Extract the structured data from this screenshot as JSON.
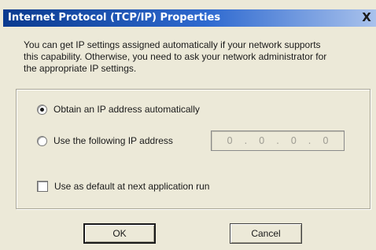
{
  "window": {
    "title": "Internet Protocol (TCP/IP) Properties",
    "close_glyph": "X"
  },
  "intro": {
    "line1": "You can get IP settings assigned automatically if your network supports",
    "line2": "this capability. Otherwise, you need to ask  your network administrator  for",
    "line3": "the appropriate  IP settings."
  },
  "options": {
    "auto_label": "Obtain an IP address automatically",
    "auto_selected": true,
    "manual_label": "Use the following IP address",
    "manual_selected": false,
    "ip_octets": [
      "0",
      "0",
      "0",
      "0"
    ],
    "ip_separator": ".",
    "default_label": "Use as default at next application run",
    "default_checked": false
  },
  "buttons": {
    "ok": "OK",
    "cancel": "Cancel"
  },
  "colors": {
    "dialog_bg": "#ece9d8",
    "titlebar_start": "#0a3a8f",
    "titlebar_end": "#a9c2ec"
  }
}
